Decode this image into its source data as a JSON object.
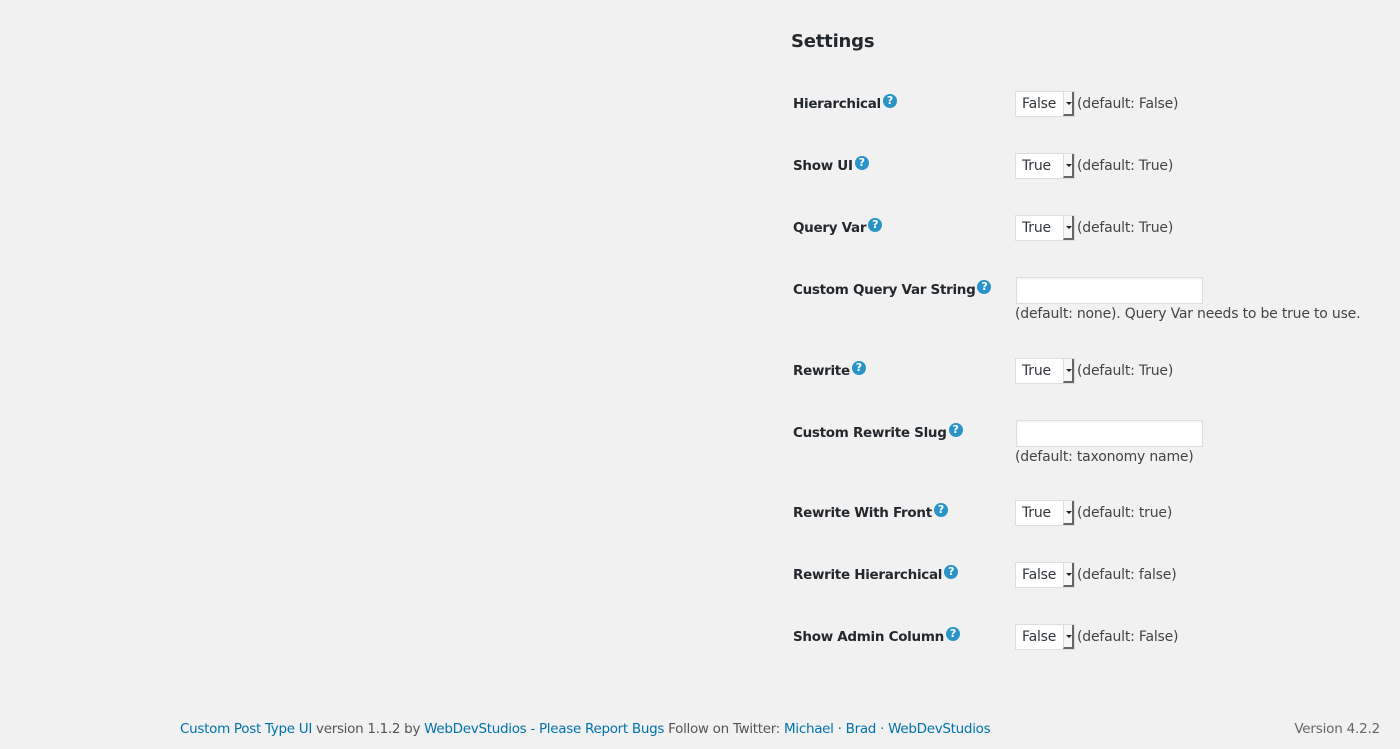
{
  "section": {
    "title": "Settings"
  },
  "icons": {
    "help": "?"
  },
  "rows": [
    {
      "label": "Hierarchical",
      "type": "select",
      "value": "False",
      "note": "(default: False)"
    },
    {
      "label": "Show UI",
      "type": "select",
      "value": "True",
      "note": "(default: True)"
    },
    {
      "label": "Query Var",
      "type": "select",
      "value": "True",
      "note": "(default: True)"
    },
    {
      "label": "Custom Query Var String",
      "type": "text",
      "value": "",
      "placeholder": "",
      "note": "(default: none). Query Var needs to be true to use."
    },
    {
      "label": "Rewrite",
      "type": "select",
      "value": "True",
      "note": "(default: True)"
    },
    {
      "label": "Custom Rewrite Slug",
      "type": "text",
      "value": "",
      "placeholder": "",
      "note": "(default: taxonomy name)"
    },
    {
      "label": "Rewrite With Front",
      "type": "select",
      "value": "True",
      "note": "(default: true)"
    },
    {
      "label": "Rewrite Hierarchical",
      "type": "select",
      "value": "False",
      "note": "(default: false)"
    },
    {
      "label": "Show Admin Column",
      "type": "select",
      "value": "False",
      "note": "(default: False)"
    }
  ],
  "footer": {
    "plugin_link": "Custom Post Type UI",
    "version_text": " version 1.1.2 by ",
    "author_link": "WebDevStudios",
    "separator": " - ",
    "bugs_link": "Please Report Bugs",
    "follow_text": " Follow on Twitter: ",
    "twitter_michael": "Michael",
    "dot1": " · ",
    "twitter_brad": "Brad",
    "dot2": " · ",
    "twitter_wds": "WebDevStudios",
    "wp_version": "Version 4.2.2"
  },
  "colors": {
    "background": "#f1f1f1",
    "link": "#0073aa",
    "help_icon": "#2a94c9",
    "text": "#23282d"
  }
}
